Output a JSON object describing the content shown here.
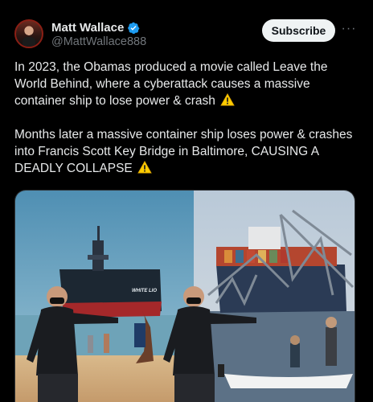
{
  "author": {
    "display_name": "Matt Wallace",
    "handle": "@MattWallace888",
    "verified_icon": "verified-badge-icon",
    "avatar": "profile-avatar"
  },
  "actions": {
    "subscribe_label": "Subscribe",
    "more_label": "···"
  },
  "tweet": {
    "paragraph1": "In 2023, the Obamas produced a movie called Leave the World Behind, where a cyberattack causes a massive container ship to lose power & crash",
    "paragraph2": "Months later a massive container ship loses power & crashes into Francis Scott Key Bridge in Baltimore, CAUSING A DEADLY COLLAPSE",
    "emoji": "warning-sign-icon"
  },
  "media": {
    "left_image": "beach-scene-with-container-ship",
    "right_image": "collapsed-bridge-on-container-ship",
    "ship_label": "WHITE LIO"
  },
  "colors": {
    "background": "#000000",
    "text": "#e7e9ea",
    "secondary_text": "#71767b",
    "verified": "#1d9bf0",
    "button_bg": "#eff3f4",
    "warning": "#ffcc00"
  }
}
